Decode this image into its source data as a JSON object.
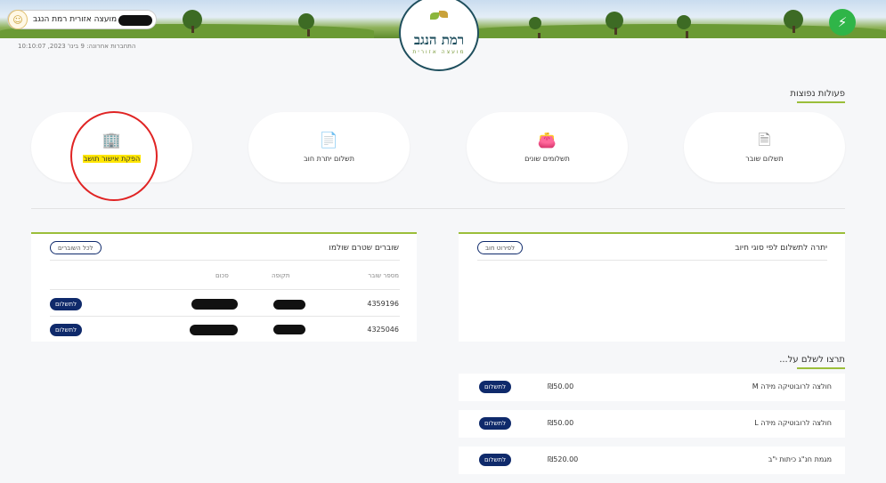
{
  "header": {
    "logo_title": "רמת הנגב",
    "logo_subtitle": "מועצה אזורית",
    "user_name": "מועצה אזורית רמת הנגב",
    "last_login": "התחברות אחרונה: 9 בינו' 2023, 10:10:07"
  },
  "colors": {
    "accent": "#9bbe3a",
    "primary_button": "#0f2a6b",
    "bolt": "#2fb548",
    "annotation": "#e02424",
    "highlight": "#ffe600"
  },
  "quick_actions": {
    "title": "פעולות נפוצות",
    "items": [
      {
        "label": "תשלום שובר",
        "icon": "receipt-icon"
      },
      {
        "label": "תשלומים שונים",
        "icon": "wallet-icon"
      },
      {
        "label": "תשלום יתרת חוב",
        "icon": "document-icon"
      },
      {
        "label": "הפקת אישור תושב",
        "icon": "building-icon"
      }
    ]
  },
  "balance_panel": {
    "title": "יתרה לתשלום לפי סוגי חיוב",
    "details_button": "לפירוט חוב"
  },
  "vouchers_panel": {
    "title": "שוברים שטרם שולמו",
    "all_button": "לכל השוברים",
    "columns": {
      "number": "מספר שובר",
      "period": "תקופה",
      "amount": "סכום"
    },
    "rows": [
      {
        "number": "4359196",
        "pay_label": "לתשלום"
      },
      {
        "number": "4325046",
        "pay_label": "לתשלום"
      }
    ]
  },
  "pay_for": {
    "title": "תרצו לשלם על...",
    "items": [
      {
        "label": "חולצה לרובוטיקה מידה M",
        "amount": "₪50.00",
        "pay_label": "לתשלום"
      },
      {
        "label": "חולצה לרובוטיקה מידה L",
        "amount": "₪50.00",
        "pay_label": "לתשלום"
      },
      {
        "label": "מגמת חנ\"ג כיתות י\"ב",
        "amount": "₪520.00",
        "pay_label": "לתשלום"
      }
    ]
  }
}
